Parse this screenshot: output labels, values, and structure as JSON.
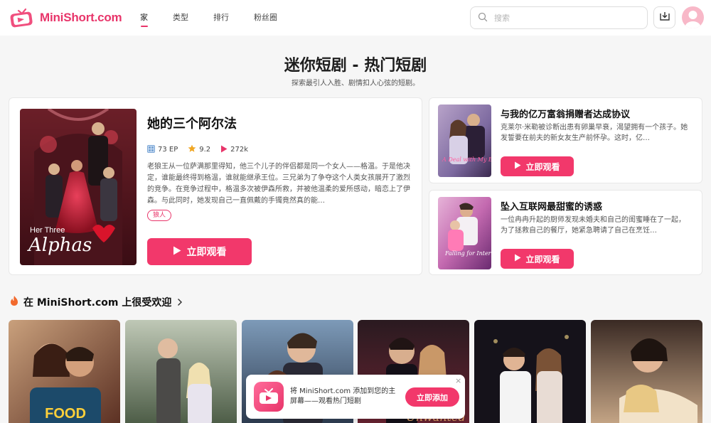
{
  "header": {
    "logo_text": "MiniShort.com",
    "nav": [
      {
        "label": "家"
      },
      {
        "label": "类型"
      },
      {
        "label": "排行"
      },
      {
        "label": "粉丝圈"
      }
    ],
    "search_placeholder": "搜索"
  },
  "hero": {
    "title": "迷你短剧 - 热门短剧",
    "subtitle": "探索最引人入胜、剧情扣人心弦的短剧。"
  },
  "featured": {
    "title": "她的三个阿尔法",
    "poster_caption_1": "Her Three",
    "poster_caption_2": "Alphas",
    "episodes": "73 EP",
    "rating": "9.2",
    "views": "272k",
    "description": "老狼王从一位萨满那里得知，他三个儿子的伴侣都是同一个女人——格温。于是他决定，谁能最终得到格温，谁就能继承王位。三兄弟为了争夺这个人类女孩展开了激烈的竞争。在竞争过程中，格温多次被伊森所救，并被他温柔的爱所感动，暗恋上了伊森。与此同时，她发现自己一直佩戴的手镯竟然真的能…",
    "tag": "狼人",
    "watch_label": "立即观看"
  },
  "side_cards": [
    {
      "title": "与我的亿万富翁捐赠者达成协议",
      "description": "克莱尔·米勒被诊断出患有卵巢早衰，渴望拥有一个孩子。她发誓要在前夫的新女友生产前怀孕。这时，亿…",
      "poster_caption": "A Deal with My Billionaire Donor",
      "watch_label": "立即观看"
    },
    {
      "title": "坠入互联网最甜蜜的诱惑",
      "description": "一位冉冉升起的厨师发现未婚夫和自己的闺蜜睡在了一起，为了拯救自己的餐厅，她紧急聘请了自己在烹饪…",
      "poster_caption": "Falling for Internet's Sweetest Temptation",
      "watch_label": "立即观看"
    }
  ],
  "popular": {
    "title": "在 MiniShort.com 上很受欢迎",
    "thumb_captions": [
      "FOOD",
      "",
      "",
      "Unwanted",
      "",
      ""
    ]
  },
  "install_prompt": {
    "text": "将 MiniShort.com 添加到您的主屏幕——观看热门短剧",
    "button": "立即添加",
    "close": "×"
  },
  "colors": {
    "accent": "#f2386b",
    "brand": "#e8356a"
  }
}
